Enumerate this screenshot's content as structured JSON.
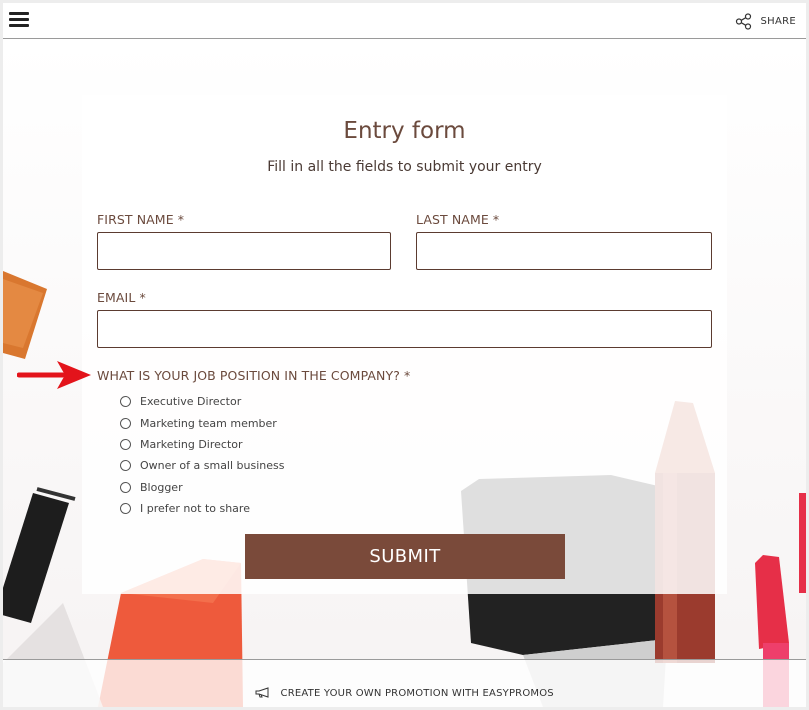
{
  "header": {
    "share_label": "SHARE"
  },
  "form": {
    "title": "Entry form",
    "subtitle": "Fill in all the fields to submit your entry",
    "first_name_label": "FIRST NAME *",
    "first_name_value": "",
    "last_name_label": "LAST NAME *",
    "last_name_value": "",
    "email_label": "EMAIL *",
    "email_value": "",
    "job_question": "WHAT IS YOUR JOB POSITION IN THE COMPANY? *",
    "job_options": [
      "Executive Director",
      "Marketing team member",
      "Marketing Director",
      "Owner of a small business",
      "Blogger",
      "I prefer not to share"
    ],
    "submit_label": "SUBMIT"
  },
  "footer": {
    "link_text": "CREATE YOUR OWN PROMOTION WITH EASYPROMOS"
  },
  "colors": {
    "accent": "#7a4a3a",
    "text_brown": "#6b4a3d",
    "annotation_arrow": "#e3141b"
  }
}
